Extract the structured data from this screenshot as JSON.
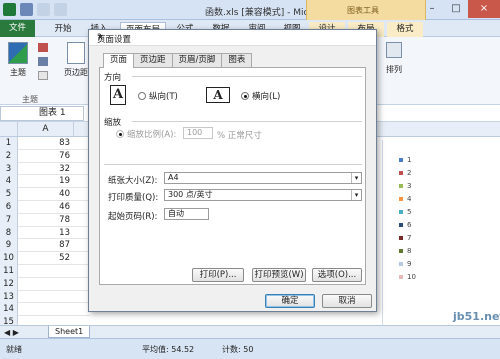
{
  "window": {
    "title": "函数.xls [兼容模式] - Microsoft Excel",
    "context_tab": "图表工具"
  },
  "ribbon_tabs": [
    "文件",
    "开始",
    "插入",
    "页面布局",
    "公式",
    "数据",
    "审阅",
    "视图",
    "设计",
    "布局",
    "格式"
  ],
  "ribbon": {
    "theme_label": "主题",
    "theme_group": "主题",
    "margin_label": "页边距",
    "arrange_label": "排列"
  },
  "formula_bar": {
    "name_box": "图表 1"
  },
  "sheet": {
    "column_header": "A",
    "rows": [
      {
        "n": "1",
        "v": "83"
      },
      {
        "n": "2",
        "v": "76"
      },
      {
        "n": "3",
        "v": "32"
      },
      {
        "n": "4",
        "v": "19"
      },
      {
        "n": "5",
        "v": "40"
      },
      {
        "n": "6",
        "v": "46"
      },
      {
        "n": "7",
        "v": "78"
      },
      {
        "n": "8",
        "v": "13"
      },
      {
        "n": "9",
        "v": "87"
      },
      {
        "n": "10",
        "v": "52"
      },
      {
        "n": "11",
        "v": ""
      },
      {
        "n": "12",
        "v": ""
      },
      {
        "n": "13",
        "v": ""
      },
      {
        "n": "14",
        "v": ""
      },
      {
        "n": "15",
        "v": ""
      }
    ],
    "tab_name": "Sheet1"
  },
  "legend": [
    {
      "label": "1",
      "color": "#4a7ec7"
    },
    {
      "label": "2",
      "color": "#c0504d"
    },
    {
      "label": "3",
      "color": "#9bbb59"
    },
    {
      "label": "4",
      "color": "#f79646"
    },
    {
      "label": "5",
      "color": "#4bacc6"
    },
    {
      "label": "6",
      "color": "#2c4d75"
    },
    {
      "label": "7",
      "color": "#772c2a"
    },
    {
      "label": "8",
      "color": "#5f7530"
    },
    {
      "label": "9",
      "color": "#b7c9e5"
    },
    {
      "label": "10",
      "color": "#e6b9b8"
    }
  ],
  "status": {
    "ready": "就绪",
    "average": "平均值: 54.52",
    "count": "计数: 50"
  },
  "watermark": "jb51.net",
  "dialog": {
    "title": "页面设置",
    "help": "?",
    "close": "×",
    "tabs": [
      "页面",
      "页边距",
      "页眉/页脚",
      "图表"
    ],
    "orientation_label": "方向",
    "portrait": "纵向(T)",
    "landscape": "横向(L)",
    "scaling_label": "缩放",
    "scale_option": "缩放比例(A):",
    "scale_value": "100",
    "scale_suffix": "% 正常尺寸",
    "paper_size_label": "纸张大小(Z):",
    "paper_size": "A4",
    "print_quality_label": "打印质量(Q):",
    "print_quality": "300 点/英寸",
    "first_page_label": "起始页码(R):",
    "first_page": "自动",
    "print_btn": "打印(P)...",
    "preview_btn": "打印预览(W)",
    "options_btn": "选项(O)...",
    "ok": "确定",
    "cancel": "取消"
  }
}
